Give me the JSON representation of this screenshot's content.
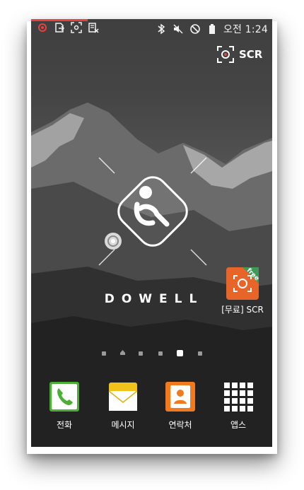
{
  "status_bar": {
    "clock": "오전 1:24",
    "left_icons": [
      "screen-recorder-icon",
      "file-export-icon",
      "screenshot-icon",
      "clipboard-x-icon"
    ],
    "right_icons": [
      "bluetooth-icon",
      "vibrate-mute-icon",
      "do-not-disturb-icon",
      "battery-icon"
    ]
  },
  "scr_overlay": {
    "label": "SCR",
    "icon": "record-frame-icon"
  },
  "wallpaper": {
    "brand": "DOWELL",
    "logo": "dowell-logo"
  },
  "home_apps": [
    {
      "label": "[무료] SCR",
      "icon": "scr-free-app-icon",
      "badge": "free",
      "color": "#e8652a"
    }
  ],
  "page_indicator": {
    "count": 6,
    "active_index": 4,
    "home_index": 1
  },
  "dock": [
    {
      "label": "전화",
      "icon": "phone-icon",
      "color": "#4cae35"
    },
    {
      "label": "메시지",
      "icon": "message-envelope-icon",
      "color": "#f1c21a"
    },
    {
      "label": "연락처",
      "icon": "contacts-icon",
      "color": "#f07a1d"
    },
    {
      "label": "앱스",
      "icon": "apps-grid-icon",
      "color": "#ffffff"
    }
  ]
}
